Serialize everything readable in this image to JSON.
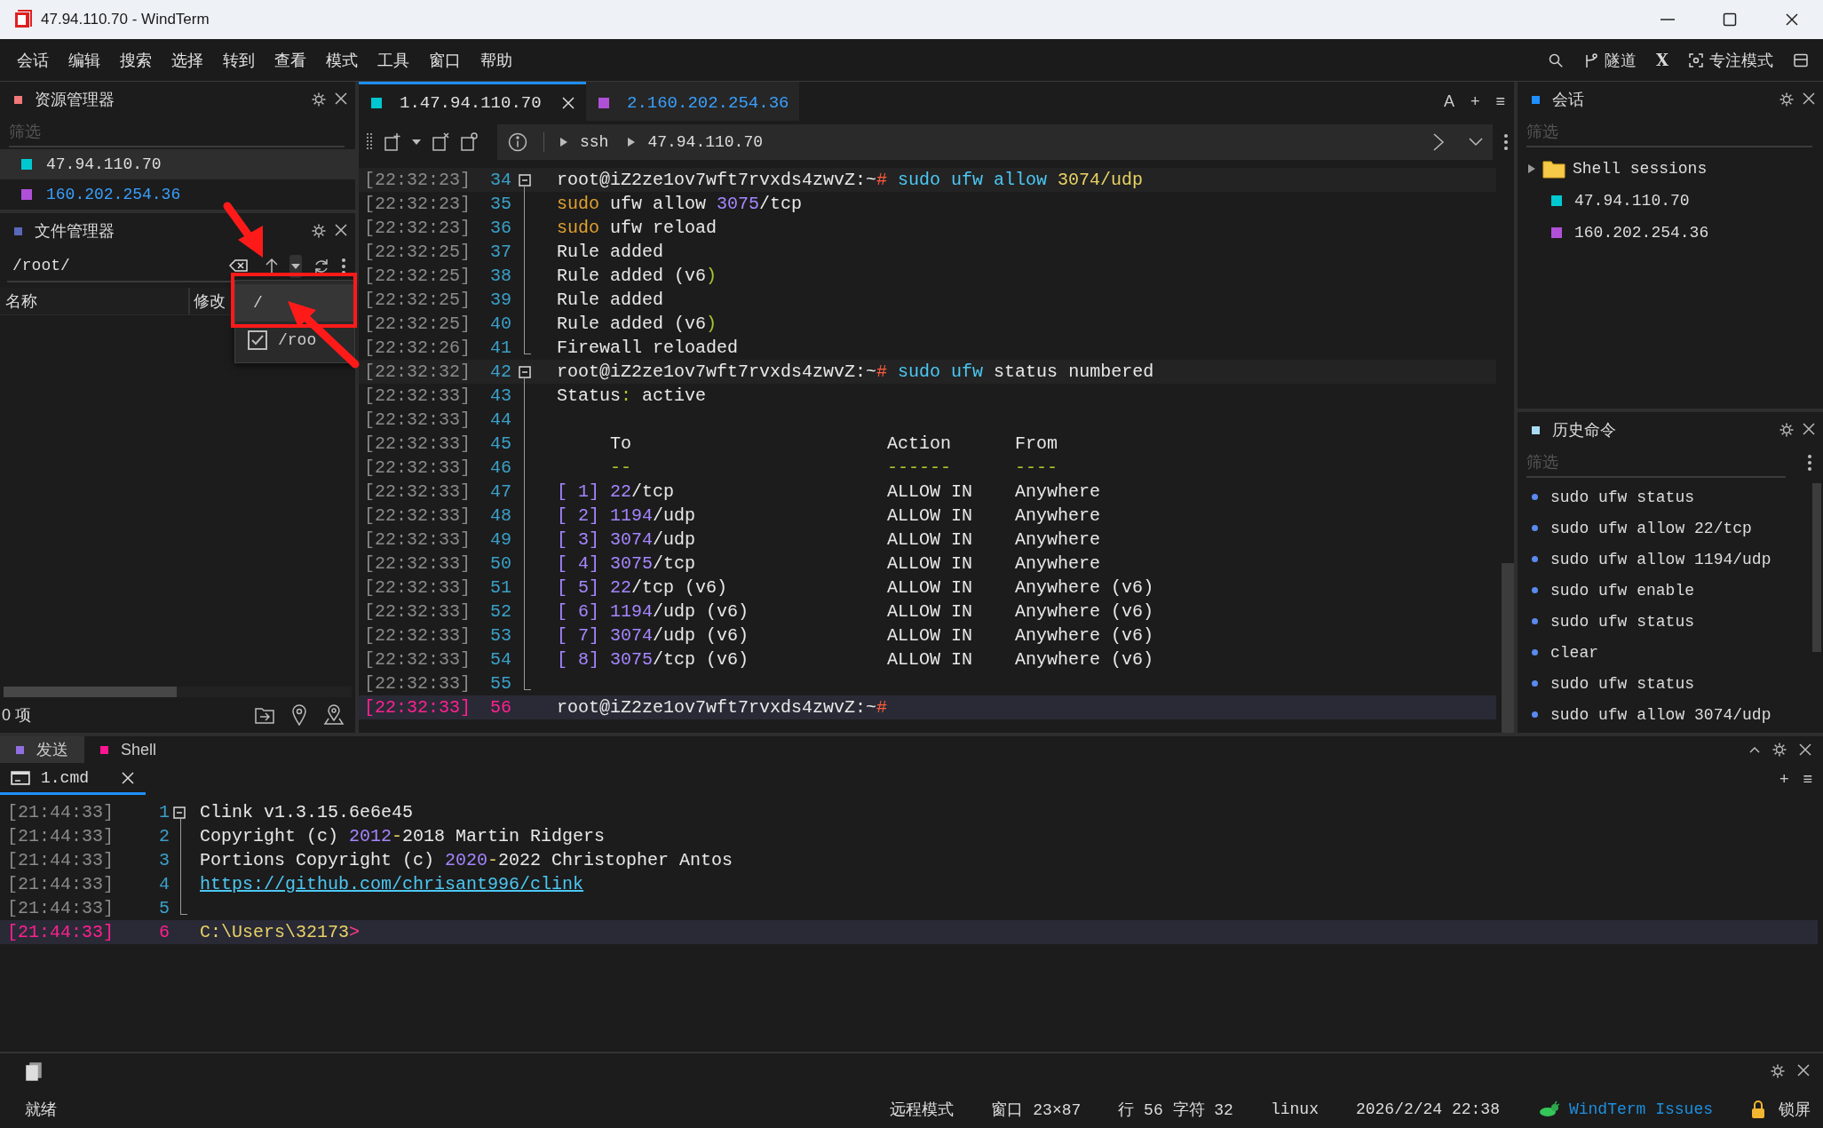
{
  "window": {
    "title": "47.94.110.70 - WindTerm"
  },
  "menu": [
    "会话",
    "编辑",
    "搜索",
    "选择",
    "转到",
    "查看",
    "模式",
    "工具",
    "窗口",
    "帮助"
  ],
  "menu_tools": [
    {
      "kind": "search"
    },
    {
      "kind": "tunnel",
      "label": "隧道"
    },
    {
      "kind": "x",
      "label": "X"
    },
    {
      "kind": "focus",
      "label": "专注模式"
    },
    {
      "kind": "layout"
    }
  ],
  "resource_panel": {
    "title": "资源管理器",
    "color": "#f07878",
    "filter_placeholder": "筛选",
    "items": [
      {
        "label": "47.94.110.70",
        "color": "#00c8d0",
        "selected": true
      },
      {
        "label": "160.202.254.36",
        "color": "#b050d8",
        "selected": false
      }
    ]
  },
  "file_panel": {
    "title": "文件管理器",
    "color": "#5a68b8",
    "path": "/root/",
    "columns": [
      "名称",
      "修改"
    ],
    "count": "0 项",
    "dropdown": [
      {
        "label": "/",
        "checked": false,
        "selected": true
      },
      {
        "label": "/roo",
        "checked": true,
        "selected": false
      }
    ]
  },
  "tabs": [
    {
      "label": "1.47.94.110.70",
      "color": "#00c8d0",
      "selected": true
    },
    {
      "label": "2.160.202.254.36",
      "color": "#b050d8",
      "selected": false
    }
  ],
  "tab_tools": [
    "A",
    "+",
    "≡"
  ],
  "breadcrumb": [
    "ssh",
    "47.94.110.70"
  ],
  "terminal": [
    {
      "time": "[22:32:23]",
      "num": "34",
      "kind": "fold_start",
      "prompt": true,
      "segs": [
        {
          "text": "root@iZ2ze1ov7wft7rvxds4zwvZ:~",
          "color": "#e8e8e8"
        },
        {
          "text": "#",
          "color": "#ff5a3c"
        },
        {
          "text": " sudo ufw allow ",
          "color": "#4cc8f4"
        },
        {
          "text": "3074/udp",
          "color": "#e8d264"
        }
      ]
    },
    {
      "time": "[22:32:23]",
      "num": "35",
      "kind": "fold_mid",
      "segs": [
        {
          "text": "sudo",
          "color": "#e0a030"
        },
        {
          "text": " ufw allow ",
          "color": "#e8e8e8"
        },
        {
          "text": "3075",
          "color": "#a585ff"
        },
        {
          "text": "/tcp",
          "color": "#e8e8e8"
        }
      ]
    },
    {
      "time": "[22:32:23]",
      "num": "36",
      "kind": "fold_mid",
      "segs": [
        {
          "text": "sudo",
          "color": "#e0a030"
        },
        {
          "text": " ufw reload",
          "color": "#e8e8e8"
        }
      ]
    },
    {
      "time": "[22:32:25]",
      "num": "37",
      "kind": "fold_mid",
      "segs": [
        {
          "text": "Rule added",
          "color": "#e8e8e8"
        }
      ]
    },
    {
      "time": "[22:32:25]",
      "num": "38",
      "kind": "fold_mid",
      "segs": [
        {
          "text": "Rule added (",
          "color": "#e8e8e8"
        },
        {
          "text": "v6",
          "color": "#e8e8e8"
        },
        {
          "text": ")",
          "color": "#a8c830"
        }
      ]
    },
    {
      "time": "[22:32:25]",
      "num": "39",
      "kind": "fold_mid",
      "segs": [
        {
          "text": "Rule added",
          "color": "#e8e8e8"
        }
      ]
    },
    {
      "time": "[22:32:25]",
      "num": "40",
      "kind": "fold_mid",
      "segs": [
        {
          "text": "Rule added (",
          "color": "#e8e8e8"
        },
        {
          "text": "v6",
          "color": "#e8e8e8"
        },
        {
          "text": ")",
          "color": "#a8c830"
        }
      ]
    },
    {
      "time": "[22:32:26]",
      "num": "41",
      "kind": "fold_end",
      "segs": [
        {
          "text": "Firewall reloaded",
          "color": "#e8e8e8"
        }
      ]
    },
    {
      "time": "[22:32:32]",
      "num": "42",
      "kind": "fold_start",
      "prompt": true,
      "segs": [
        {
          "text": "root@iZ2ze1ov7wft7rvxds4zwvZ:~",
          "color": "#e8e8e8"
        },
        {
          "text": "#",
          "color": "#ff5a3c"
        },
        {
          "text": " sudo ufw",
          "color": "#4cc8f4"
        },
        {
          "text": " status numbered",
          "color": "#e8e8e8"
        }
      ]
    },
    {
      "time": "[22:32:33]",
      "num": "43",
      "kind": "fold_mid",
      "segs": [
        {
          "text": "Status",
          "color": "#e8e8e8"
        },
        {
          "text": ":",
          "color": "#a8c830"
        },
        {
          "text": " active",
          "color": "#e8e8e8"
        }
      ]
    },
    {
      "time": "[22:32:33]",
      "num": "44",
      "kind": "fold_mid"
    },
    {
      "time": "[22:32:33]",
      "num": "45",
      "kind": "fold_mid",
      "segs": [
        {
          "text": "     To                        Action      From",
          "color": "#e8e8e8"
        }
      ]
    },
    {
      "time": "[22:32:33]",
      "num": "46",
      "kind": "fold_mid",
      "segs": [
        {
          "text": "     --                        ------      ----",
          "color": "#a8c830"
        }
      ]
    },
    {
      "time": "[22:32:33]",
      "num": "47",
      "kind": "fold_mid",
      "segs": [
        {
          "text": "[ 1]",
          "color": "#a585ff"
        },
        {
          "text": " 22",
          "color": "#a585ff"
        },
        {
          "text": "/tcp                    ALLOW IN    Anywhere",
          "color": "#e8e8e8"
        }
      ]
    },
    {
      "time": "[22:32:33]",
      "num": "48",
      "kind": "fold_mid",
      "segs": [
        {
          "text": "[ 2]",
          "color": "#a585ff"
        },
        {
          "text": " 1194",
          "color": "#a585ff"
        },
        {
          "text": "/udp                  ALLOW IN    Anywhere",
          "color": "#e8e8e8"
        }
      ]
    },
    {
      "time": "[22:32:33]",
      "num": "49",
      "kind": "fold_mid",
      "segs": [
        {
          "text": "[ 3]",
          "color": "#a585ff"
        },
        {
          "text": " 3074",
          "color": "#a585ff"
        },
        {
          "text": "/udp                  ALLOW IN    Anywhere",
          "color": "#e8e8e8"
        }
      ]
    },
    {
      "time": "[22:32:33]",
      "num": "50",
      "kind": "fold_mid",
      "segs": [
        {
          "text": "[ 4]",
          "color": "#a585ff"
        },
        {
          "text": " 3075",
          "color": "#a585ff"
        },
        {
          "text": "/tcp                  ALLOW IN    Anywhere",
          "color": "#e8e8e8"
        }
      ]
    },
    {
      "time": "[22:32:33]",
      "num": "51",
      "kind": "fold_mid",
      "segs": [
        {
          "text": "[ 5]",
          "color": "#a585ff"
        },
        {
          "text": " 22",
          "color": "#a585ff"
        },
        {
          "text": "/tcp (v6)               ALLOW IN    Anywhere (v6)",
          "color": "#e8e8e8"
        }
      ]
    },
    {
      "time": "[22:32:33]",
      "num": "52",
      "kind": "fold_mid",
      "segs": [
        {
          "text": "[ 6]",
          "color": "#a585ff"
        },
        {
          "text": " 1194",
          "color": "#a585ff"
        },
        {
          "text": "/udp (v6)             ALLOW IN    Anywhere (v6)",
          "color": "#e8e8e8"
        }
      ]
    },
    {
      "time": "[22:32:33]",
      "num": "53",
      "kind": "fold_mid",
      "segs": [
        {
          "text": "[ 7]",
          "color": "#a585ff"
        },
        {
          "text": " 3074",
          "color": "#a585ff"
        },
        {
          "text": "/udp (v6)             ALLOW IN    Anywhere (v6)",
          "color": "#e8e8e8"
        }
      ]
    },
    {
      "time": "[22:32:33]",
      "num": "54",
      "kind": "fold_mid",
      "segs": [
        {
          "text": "[ 8]",
          "color": "#a585ff"
        },
        {
          "text": " 3075",
          "color": "#a585ff"
        },
        {
          "text": "/tcp (v6)             ALLOW IN    Anywhere (v6)",
          "color": "#e8e8e8"
        }
      ]
    },
    {
      "time": "[22:32:33]",
      "num": "55",
      "kind": "fold_end"
    },
    {
      "time": "[22:32:33]",
      "num": "56",
      "current": true,
      "segs": [
        {
          "text": "root@iZ2ze1ov7wft7rvxds4zwvZ:~",
          "color": "#e8e8e8"
        },
        {
          "text": "#",
          "color": "#ff5a3c"
        }
      ]
    }
  ],
  "sessions_panel": {
    "title": "会话",
    "color": "#2090ff",
    "filter_placeholder": "筛选",
    "items": [
      {
        "kind": "folder",
        "label": "Shell sessions",
        "expanded": false
      },
      {
        "kind": "session",
        "label": "47.94.110.70",
        "color": "#00c8d0"
      },
      {
        "kind": "session",
        "label": "160.202.254.36",
        "color": "#b050d8"
      }
    ]
  },
  "history_panel": {
    "title": "历史命令",
    "color": "#a8dcf4",
    "filter_placeholder": "筛选",
    "items": [
      "sudo ufw status",
      "sudo ufw allow 22/tcp",
      "sudo ufw allow 1194/udp",
      "sudo ufw enable",
      "sudo ufw status",
      "clear",
      "sudo ufw status",
      "sudo ufw allow 3074/udp"
    ]
  },
  "bottom_tabs": [
    {
      "label": "发送",
      "color": "#9070e0",
      "selected": true
    },
    {
      "label": "Shell",
      "color": "#ff1493",
      "selected": false
    }
  ],
  "shell_tab": {
    "label": "1.cmd",
    "selected": true
  },
  "shell_tools": [
    "+",
    "≡"
  ],
  "shell": [
    {
      "time": "[21:44:33]",
      "num": "1",
      "kind": "fold_start",
      "segs": [
        {
          "text": "Clink v1.3.15.6e6e45",
          "color": "#e8e8e8"
        }
      ]
    },
    {
      "time": "[21:44:33]",
      "num": "2",
      "kind": "fold_mid",
      "segs": [
        {
          "text": "Copyright (c)",
          "color": "#e8e8e8"
        },
        {
          "text": " 2012",
          "color": "#a585ff"
        },
        {
          "text": "-",
          "color": "#e8d264"
        },
        {
          "text": "2018 Martin Ridgers",
          "color": "#e8e8e8"
        }
      ]
    },
    {
      "time": "[21:44:33]",
      "num": "3",
      "kind": "fold_mid",
      "segs": [
        {
          "text": "Portions Copyright (c)",
          "color": "#e8e8e8"
        },
        {
          "text": " 2020",
          "color": "#a585ff"
        },
        {
          "text": "-",
          "color": "#e8d264"
        },
        {
          "text": "2022 Christopher Antos",
          "color": "#e8e8e8"
        }
      ]
    },
    {
      "time": "[21:44:33]",
      "num": "4",
      "kind": "fold_mid",
      "segs": [
        {
          "text": "https://github.com/chrisant996/clink",
          "color": "#4cc8f4",
          "link": true
        }
      ]
    },
    {
      "time": "[21:44:33]",
      "num": "5",
      "kind": "fold_end"
    },
    {
      "time": "[21:44:33]",
      "num": "6",
      "current": true,
      "segs": [
        {
          "text": "C:\\Users\\32173",
          "color": "#e8d264"
        },
        {
          "text": ">",
          "color": "#ff3c8c"
        }
      ]
    }
  ],
  "status_bar": {
    "left": "就绪",
    "items": [
      {
        "kind": "text",
        "label": "远程模式"
      },
      {
        "kind": "text",
        "label": "窗口 23×87"
      },
      {
        "kind": "text",
        "label": "行 56 字符 32"
      },
      {
        "kind": "text",
        "label": "linux"
      },
      {
        "kind": "text",
        "label": "2026/2/24 22:38"
      },
      {
        "kind": "link",
        "label": "WindTerm Issues"
      },
      {
        "kind": "lock",
        "label": "锁屏"
      }
    ]
  },
  "annotations": [
    {
      "kind": "arrow_down"
    },
    {
      "kind": "arrow_up"
    },
    {
      "kind": "box"
    }
  ]
}
